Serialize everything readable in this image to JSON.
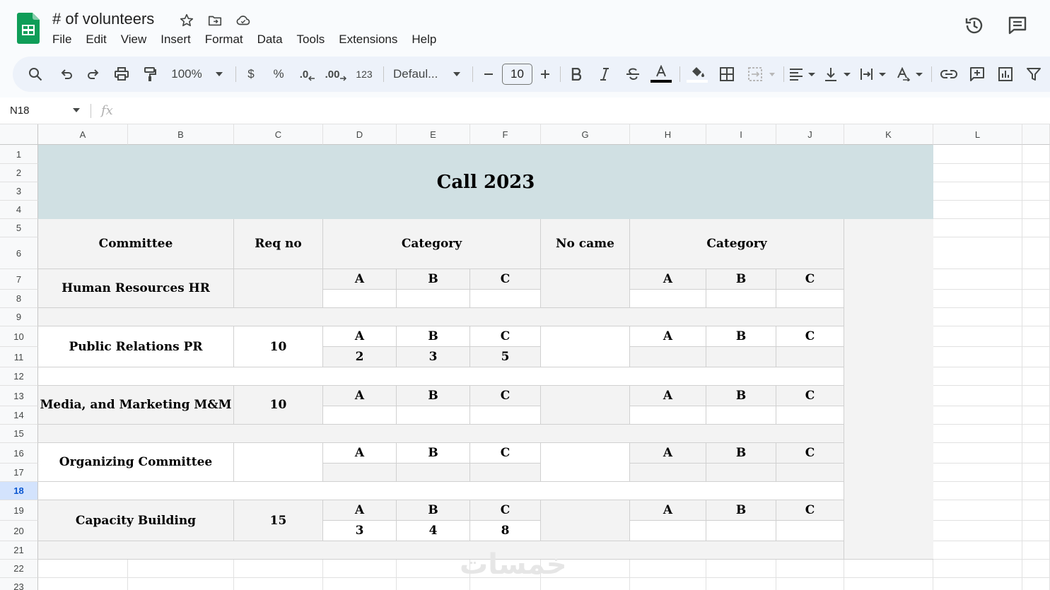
{
  "doc": {
    "title": "# of volunteers"
  },
  "menu": [
    "File",
    "Edit",
    "View",
    "Insert",
    "Format",
    "Data",
    "Tools",
    "Extensions",
    "Help"
  ],
  "toolbar": {
    "zoom": "100%",
    "currency": "$",
    "percent": "%",
    "decimal_decrease": ".0",
    "decimal_increase": ".00",
    "number_format": "123",
    "font": "Defaul...",
    "font_size": "10"
  },
  "formula_bar": {
    "name_box": "N18",
    "fx": "fx"
  },
  "columns": [
    "A",
    "B",
    "C",
    "D",
    "E",
    "F",
    "G",
    "H",
    "I",
    "J",
    "K",
    "L"
  ],
  "rows": [
    "1",
    "2",
    "3",
    "4",
    "5",
    "6",
    "7",
    "8",
    "9",
    "10",
    "11",
    "12",
    "13",
    "14",
    "15",
    "16",
    "17",
    "18",
    "19",
    "20",
    "21",
    "22",
    "23"
  ],
  "selected_row": "18",
  "sheet": {
    "title": "Call 2023",
    "headers": {
      "committee": "Committee",
      "req_no": "Req no",
      "category_left": "Category",
      "no_came": "No came",
      "category_right": "Category"
    },
    "committees": [
      {
        "name": "Human Resources HR",
        "req": "",
        "cat_labels": [
          "A",
          "B",
          "C"
        ],
        "req_values": [
          "",
          "",
          ""
        ],
        "came_labels": [
          "A",
          "B",
          "C"
        ],
        "came_values": [
          "",
          "",
          ""
        ]
      },
      {
        "name": "Public Relations PR",
        "req": "10",
        "cat_labels": [
          "A",
          "B",
          "C"
        ],
        "req_values": [
          "2",
          "3",
          "5"
        ],
        "came_labels": [
          "A",
          "B",
          "C"
        ],
        "came_values": [
          "",
          "",
          ""
        ]
      },
      {
        "name": "Media, and Marketing M&M",
        "req": "10",
        "cat_labels": [
          "A",
          "B",
          "C"
        ],
        "req_values": [
          "",
          "",
          ""
        ],
        "came_labels": [
          "A",
          "B",
          "C"
        ],
        "came_values": [
          "",
          "",
          ""
        ]
      },
      {
        "name": "Organizing Committee",
        "req": "",
        "cat_labels": [
          "A",
          "B",
          "C"
        ],
        "req_values": [
          "",
          "",
          ""
        ],
        "came_labels": [
          "A",
          "B",
          "C"
        ],
        "came_values": [
          "",
          "",
          ""
        ]
      },
      {
        "name": "Capacity Building",
        "req": "15",
        "cat_labels": [
          "A",
          "B",
          "C"
        ],
        "req_values": [
          "3",
          "4",
          "8"
        ],
        "came_labels": [
          "A",
          "B",
          "C"
        ],
        "came_values": [
          "",
          "",
          ""
        ]
      }
    ]
  },
  "watermark": "خمسات"
}
